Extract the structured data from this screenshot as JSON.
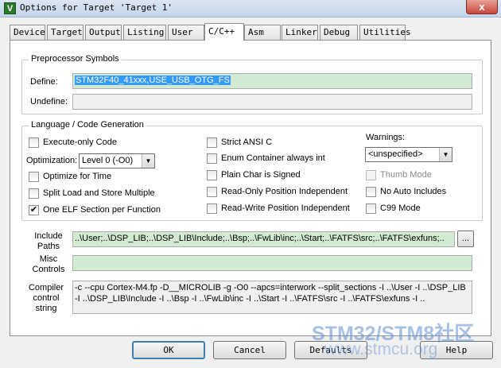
{
  "window": {
    "title": "Options for Target 'Target 1'",
    "close_glyph": "x",
    "app_icon": "uvision-icon"
  },
  "tabs": [
    {
      "label": "Device",
      "active": false
    },
    {
      "label": "Target",
      "active": false
    },
    {
      "label": "Output",
      "active": false
    },
    {
      "label": "Listing",
      "active": false
    },
    {
      "label": "User",
      "active": false
    },
    {
      "label": "C/C++",
      "active": true
    },
    {
      "label": "Asm",
      "active": false
    },
    {
      "label": "Linker",
      "active": false
    },
    {
      "label": "Debug",
      "active": false
    },
    {
      "label": "Utilities",
      "active": false
    }
  ],
  "preprocessor": {
    "title": "Preprocessor Symbols",
    "define_label": "Define:",
    "define_value": "STM32F40_41xxx,USE_USB_OTG_FS",
    "undefine_label": "Undefine:",
    "undefine_value": ""
  },
  "language": {
    "title": "Language / Code Generation",
    "execute_only": {
      "label": "Execute-only Code",
      "checked": false
    },
    "optimization_label": "Optimization:",
    "optimization_value": "Level 0 (-O0)",
    "optimize_time": {
      "label": "Optimize for Time",
      "checked": false
    },
    "split_load": {
      "label": "Split Load and Store Multiple",
      "checked": false
    },
    "one_elf": {
      "label": "One ELF Section per Function",
      "checked": true
    },
    "strict_ansi": {
      "label": "Strict ANSI C",
      "checked": false
    },
    "enum_container": {
      "label": "Enum Container always int",
      "checked": false
    },
    "plain_char": {
      "label": "Plain Char is Signed",
      "checked": false
    },
    "ro_position": {
      "label": "Read-Only Position Independent",
      "checked": false
    },
    "rw_position": {
      "label": "Read-Write Position Independent",
      "checked": false
    },
    "warnings_label": "Warnings:",
    "warnings_value": "<unspecified>",
    "thumb_mode": {
      "label": "Thumb Mode",
      "checked": false,
      "disabled": true
    },
    "no_auto_includes": {
      "label": "No Auto Includes",
      "checked": false
    },
    "c99_mode": {
      "label": "C99 Mode",
      "checked": false
    },
    "check_glyph": "✔"
  },
  "include_paths": {
    "label_line1": "Include",
    "label_line2": "Paths",
    "value": "..\\User;..\\DSP_LIB;..\\DSP_LIB\\Include;..\\Bsp;..\\FwLib\\inc;..\\Start;..\\FATFS\\src;..\\FATFS\\exfuns;..",
    "browse_label": "..."
  },
  "misc_controls": {
    "label_line1": "Misc",
    "label_line2": "Controls",
    "value": ""
  },
  "compiler_string": {
    "label_line1": "Compiler",
    "label_line2": "control",
    "label_line3": "string",
    "value": "-c --cpu Cortex-M4.fp -D__MICROLIB -g -O0 --apcs=interwork --split_sections -I ..\\User -I ..\\DSP_LIB -I ..\\DSP_LIB\\Include -I ..\\Bsp -I ..\\FwLib\\inc -I ..\\Start -I ..\\FATFS\\src -I ..\\FATFS\\exfuns -I .."
  },
  "buttons": {
    "ok": "OK",
    "cancel": "Cancel",
    "defaults": "Defaults",
    "help": "Help"
  },
  "watermark": {
    "line1": "STM32/STM8社区",
    "line2": "www.stmcu.org"
  }
}
